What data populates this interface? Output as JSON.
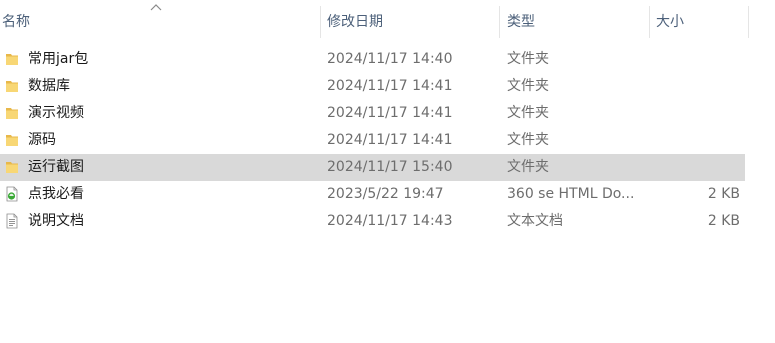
{
  "columns": {
    "name": "名称",
    "modified": "修改日期",
    "type": "类型",
    "size": "大小"
  },
  "files": [
    {
      "name": "常用jar包",
      "modified": "2024/11/17 14:40",
      "type": "文件夹",
      "size": "",
      "icon": "folder-icon"
    },
    {
      "name": "数据库",
      "modified": "2024/11/17 14:41",
      "type": "文件夹",
      "size": "",
      "icon": "folder-icon"
    },
    {
      "name": "演示视频",
      "modified": "2024/11/17 14:41",
      "type": "文件夹",
      "size": "",
      "icon": "folder-icon"
    },
    {
      "name": "源码",
      "modified": "2024/11/17 14:41",
      "type": "文件夹",
      "size": "",
      "icon": "folder-icon"
    },
    {
      "name": "运行截图",
      "modified": "2024/11/17 15:40",
      "type": "文件夹",
      "size": "",
      "icon": "folder-icon"
    },
    {
      "name": "点我必看",
      "modified": "2023/5/22 19:47",
      "type": "360 se HTML Do...",
      "size": "2 KB",
      "icon": "html-file-icon"
    },
    {
      "name": "说明文档",
      "modified": "2024/11/17 14:43",
      "type": "文本文档",
      "size": "2 KB",
      "icon": "text-file-icon"
    }
  ],
  "selected_row": 4,
  "colors": {
    "selected": "#d9d9d9",
    "header_text": "#4c607a",
    "folder": "#f8d775"
  }
}
